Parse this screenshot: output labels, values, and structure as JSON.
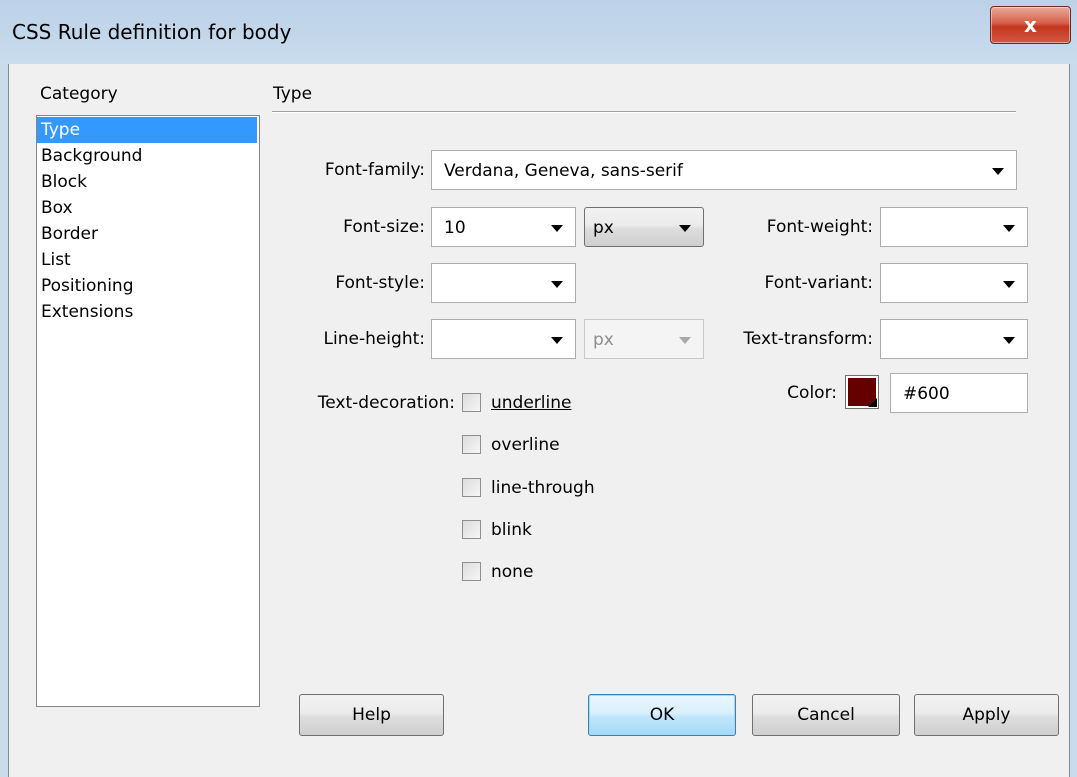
{
  "window": {
    "title": "CSS Rule definition for body",
    "close_icon": "close-icon",
    "close_glyph": "x"
  },
  "category": {
    "header": "Category",
    "items": [
      "Type",
      "Background",
      "Block",
      "Box",
      "Border",
      "List",
      "Positioning",
      "Extensions"
    ],
    "selected": "Type"
  },
  "panel": {
    "title": "Type"
  },
  "fields": {
    "font_family": {
      "label": "Font-family:",
      "value": "Verdana, Geneva, sans-serif"
    },
    "font_size": {
      "label": "Font-size:",
      "value": "10",
      "unit": "px"
    },
    "font_weight": {
      "label": "Font-weight:",
      "value": ""
    },
    "font_style": {
      "label": "Font-style:",
      "value": ""
    },
    "font_variant": {
      "label": "Font-variant:",
      "value": ""
    },
    "line_height": {
      "label": "Line-height:",
      "value": "",
      "unit": "px"
    },
    "text_transform": {
      "label": "Text-transform:",
      "value": ""
    },
    "color": {
      "label": "Color:",
      "value": "#600",
      "swatch": "#660000"
    },
    "text_decoration": {
      "label": "Text-decoration:",
      "options": [
        {
          "label": "underline",
          "checked": false
        },
        {
          "label": "overline",
          "checked": false
        },
        {
          "label": "line-through",
          "checked": false
        },
        {
          "label": "blink",
          "checked": false
        },
        {
          "label": "none",
          "checked": false
        }
      ]
    }
  },
  "buttons": {
    "help": "Help",
    "ok": "OK",
    "cancel": "Cancel",
    "apply": "Apply"
  }
}
